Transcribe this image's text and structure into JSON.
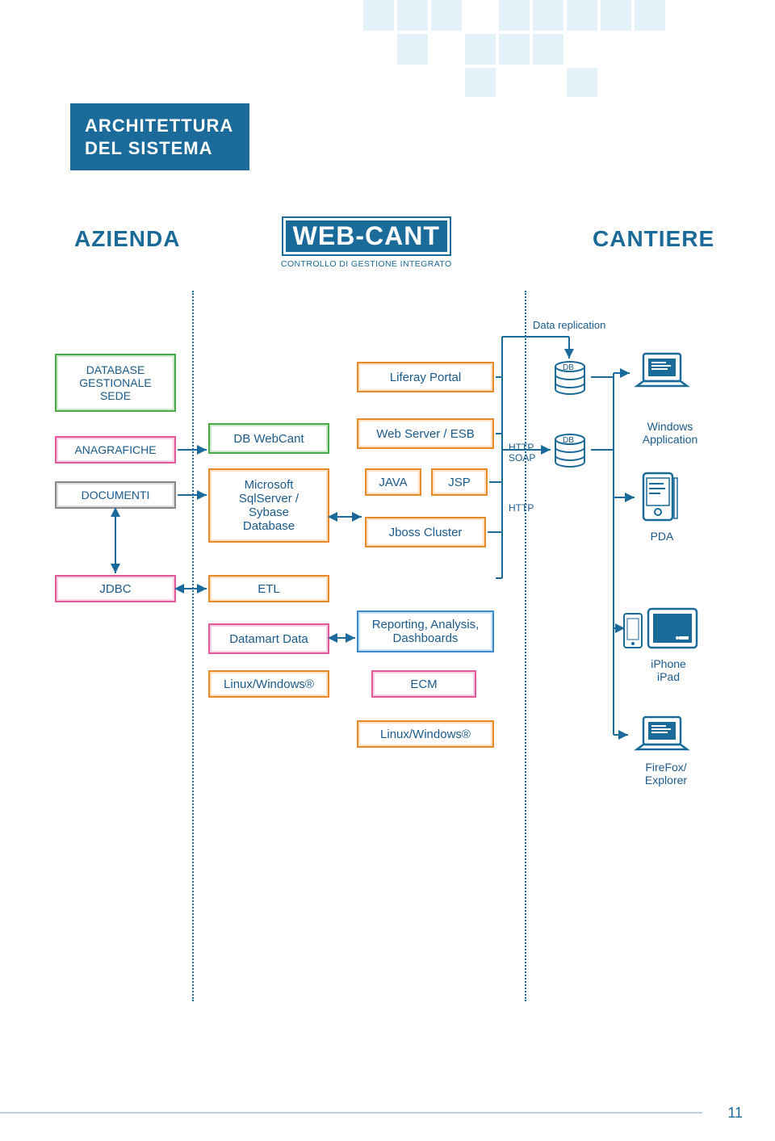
{
  "header": {
    "title_line1": "ARCHITETTURA",
    "title_line2": "DEL SISTEMA"
  },
  "columns": {
    "left": "AZIENDA",
    "right": "CANTIERE"
  },
  "logo": {
    "main": "WEB-CANT",
    "sub": "CONTROLLO DI GESTIONE INTEGRATO"
  },
  "labels": {
    "data_replication": "Data replication",
    "http_soap": "HTTP\nSOAP",
    "http": "HTTP",
    "db1": "DB",
    "db2": "DB"
  },
  "left_stack": {
    "database": "DATABASE\nGESTIONALE\nSEDE",
    "anagrafiche": "ANAGRAFICHE",
    "documenti": "DOCUMENTI",
    "jdbc": "JDBC"
  },
  "mid_stack": {
    "db_webcant": "DB WebCant",
    "ms_db": "Microsoft\nSqlServer /\nSybase\nDatabase",
    "etl": "ETL",
    "datamart": "Datamart Data",
    "linux_win": "Linux/Windows®"
  },
  "center_stack": {
    "liferay": "Liferay Portal",
    "web_esb": "Web Server / ESB",
    "java": "JAVA",
    "jsp": "JSP",
    "jboss": "Jboss Cluster",
    "reporting": "Reporting, Analysis,\nDashboards",
    "ecm": "ECM",
    "linux_win": "Linux/Windows®"
  },
  "right_icons": {
    "windows_app": "Windows\nApplication",
    "pda": "PDA",
    "iphone_ipad": "iPhone\niPad",
    "firefox": "FireFox/\nExplorer"
  },
  "page_number": "11"
}
